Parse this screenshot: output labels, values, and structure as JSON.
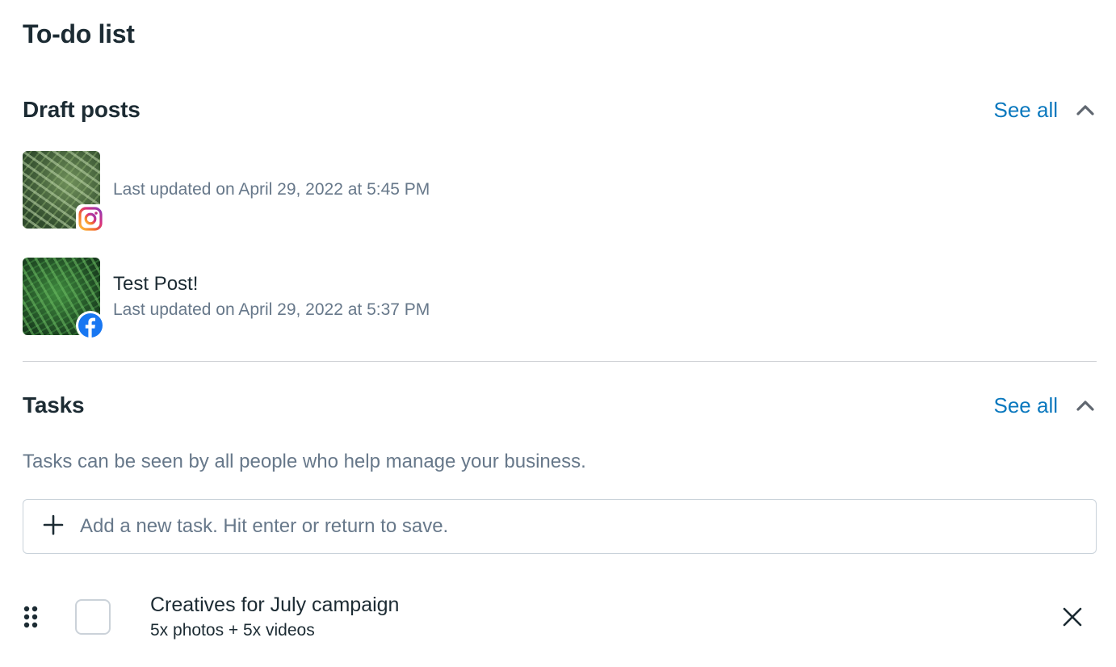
{
  "page": {
    "title": "To-do list"
  },
  "draft_posts": {
    "title": "Draft posts",
    "see_all_label": "See all",
    "collapse_icon": "chevron-up-icon",
    "items": [
      {
        "title": "",
        "meta": "Last updated on April 29, 2022 at 5:45 PM",
        "platform": "instagram",
        "platform_icon": "instagram-icon"
      },
      {
        "title": "Test Post!",
        "meta": "Last updated on April 29, 2022 at 5:37 PM",
        "platform": "facebook",
        "platform_icon": "facebook-icon"
      }
    ]
  },
  "tasks": {
    "title": "Tasks",
    "see_all_label": "See all",
    "collapse_icon": "chevron-up-icon",
    "description": "Tasks can be seen by all people who help manage your business.",
    "add_task": {
      "placeholder": "Add a new task. Hit enter or return to save.",
      "value": "",
      "icon": "plus-icon"
    },
    "items": [
      {
        "title": "Creatives for July campaign",
        "subtitle": "5x photos + 5x videos",
        "checked": false
      }
    ]
  },
  "colors": {
    "link": "#0a78be",
    "heading": "#1c2b33",
    "secondary_text": "#67788a",
    "divider": "#ced0d4",
    "facebook": "#1877f2"
  }
}
